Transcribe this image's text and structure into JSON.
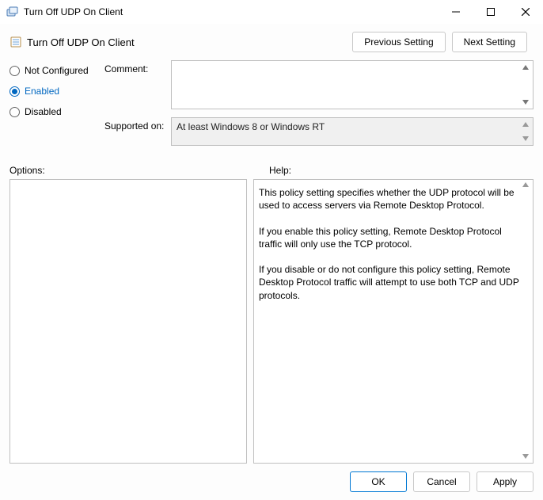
{
  "window": {
    "title": "Turn Off UDP On Client"
  },
  "header": {
    "policy_title": "Turn Off UDP On Client",
    "previous_btn": "Previous Setting",
    "next_btn": "Next Setting"
  },
  "radios": {
    "not_configured": "Not Configured",
    "enabled": "Enabled",
    "disabled": "Disabled",
    "selected": "enabled"
  },
  "fields": {
    "comment_label": "Comment:",
    "comment_value": "",
    "supported_label": "Supported on:",
    "supported_value": "At least Windows 8 or Windows RT"
  },
  "labels": {
    "options": "Options:",
    "help": "Help:"
  },
  "help_text": {
    "p1": "This policy setting specifies whether the UDP protocol will be used to access servers via Remote Desktop Protocol.",
    "p2": "If you enable this policy setting, Remote Desktop Protocol traffic will only use the TCP protocol.",
    "p3": "If you disable or do not configure this policy setting, Remote Desktop Protocol traffic will attempt to use both TCP and UDP protocols."
  },
  "footer": {
    "ok": "OK",
    "cancel": "Cancel",
    "apply": "Apply"
  }
}
